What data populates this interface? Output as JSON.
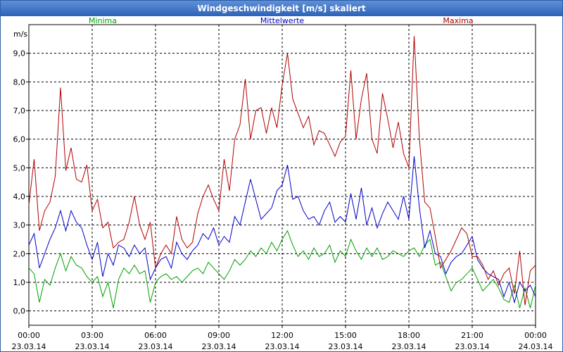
{
  "window": {
    "title": "Windgeschwindigkeit [m/s] skaliert"
  },
  "chart_data": {
    "type": "line",
    "title": "Windgeschwindigkeit [m/s] skaliert",
    "ylabel": "m/s",
    "xlabel": "",
    "ylim": [
      -0.5,
      10.0
    ],
    "xlim": [
      0,
      24
    ],
    "grid": true,
    "legend_position": "top",
    "y_ticks": [
      "0,0",
      "1,0",
      "2,0",
      "3,0",
      "4,0",
      "5,0",
      "6,0",
      "7,0",
      "8,0",
      "9,0"
    ],
    "y_tick_values": [
      0,
      1,
      2,
      3,
      4,
      5,
      6,
      7,
      8,
      9
    ],
    "x_tick_values": [
      0,
      3,
      6,
      9,
      12,
      15,
      18,
      21,
      24
    ],
    "x_ticks_time": [
      "00:00",
      "03:00",
      "06:00",
      "09:00",
      "12:00",
      "15:00",
      "18:00",
      "21:00",
      "00:00"
    ],
    "x_ticks_date": [
      "23.03.14",
      "23.03.14",
      "23.03.14",
      "23.03.14",
      "23.03.14",
      "23.03.14",
      "23.03.14",
      "23.03.14",
      "24.03.14"
    ],
    "x": [
      0.0,
      0.25,
      0.5,
      0.75,
      1.0,
      1.25,
      1.5,
      1.75,
      2.0,
      2.25,
      2.5,
      2.75,
      3.0,
      3.25,
      3.5,
      3.75,
      4.0,
      4.25,
      4.5,
      4.75,
      5.0,
      5.25,
      5.5,
      5.75,
      6.0,
      6.25,
      6.5,
      6.75,
      7.0,
      7.25,
      7.5,
      7.75,
      8.0,
      8.25,
      8.5,
      8.75,
      9.0,
      9.25,
      9.5,
      9.75,
      10.0,
      10.25,
      10.5,
      10.75,
      11.0,
      11.25,
      11.5,
      11.75,
      12.0,
      12.25,
      12.5,
      12.75,
      13.0,
      13.25,
      13.5,
      13.75,
      14.0,
      14.25,
      14.5,
      14.75,
      15.0,
      15.25,
      15.5,
      15.75,
      16.0,
      16.25,
      16.5,
      16.75,
      17.0,
      17.25,
      17.5,
      17.75,
      18.0,
      18.25,
      18.5,
      18.75,
      19.0,
      19.25,
      19.5,
      19.75,
      20.0,
      20.25,
      20.5,
      20.75,
      21.0,
      21.25,
      21.5,
      21.75,
      22.0,
      22.25,
      22.5,
      22.75,
      23.0,
      23.25,
      23.5,
      23.75,
      24.0
    ],
    "series": [
      {
        "name": "Minima",
        "color": "#00a000",
        "values": [
          1.5,
          1.3,
          0.3,
          1.1,
          0.9,
          1.5,
          2.0,
          1.4,
          1.9,
          1.6,
          1.5,
          1.2,
          1.0,
          1.2,
          0.5,
          1.0,
          0.1,
          1.1,
          1.5,
          1.3,
          1.6,
          1.3,
          1.4,
          0.3,
          1.0,
          1.2,
          1.3,
          1.1,
          1.2,
          1.0,
          1.2,
          1.4,
          1.5,
          1.3,
          1.7,
          1.5,
          1.3,
          1.1,
          1.4,
          1.8,
          1.6,
          1.8,
          2.1,
          1.9,
          2.2,
          2.0,
          2.4,
          2.1,
          2.5,
          2.8,
          2.3,
          1.9,
          2.1,
          1.8,
          2.2,
          1.9,
          2.0,
          2.3,
          1.7,
          2.1,
          1.9,
          2.5,
          2.1,
          1.8,
          2.2,
          1.9,
          2.2,
          1.8,
          1.9,
          2.1,
          2.0,
          1.9,
          2.1,
          2.2,
          1.9,
          2.3,
          2.5,
          1.6,
          1.7,
          1.2,
          0.7,
          1.0,
          1.1,
          1.3,
          1.5,
          1.1,
          0.7,
          0.9,
          1.1,
          0.8,
          0.4,
          0.3,
          0.9,
          0.1,
          0.8,
          0.1,
          0.9
        ]
      },
      {
        "name": "Mittelwerte",
        "color": "#0000c8",
        "values": [
          2.3,
          2.7,
          1.5,
          2.0,
          2.5,
          2.9,
          3.5,
          2.8,
          3.5,
          3.1,
          2.9,
          2.3,
          1.8,
          2.4,
          1.2,
          2.0,
          1.6,
          2.3,
          2.2,
          1.9,
          2.3,
          2.0,
          2.2,
          1.1,
          1.5,
          1.8,
          1.9,
          1.5,
          2.4,
          2.0,
          1.8,
          2.1,
          2.3,
          2.7,
          2.5,
          2.9,
          2.3,
          2.6,
          2.4,
          3.3,
          3.0,
          3.8,
          4.6,
          3.9,
          3.2,
          3.4,
          3.6,
          4.2,
          4.4,
          5.1,
          3.9,
          4.0,
          3.5,
          3.2,
          3.3,
          3.0,
          3.5,
          3.8,
          3.1,
          3.3,
          3.1,
          4.1,
          3.2,
          4.3,
          3.0,
          3.6,
          2.9,
          3.4,
          3.8,
          3.5,
          3.2,
          4.0,
          3.2,
          5.4,
          3.6,
          2.2,
          2.8,
          2.0,
          1.9,
          1.3,
          1.7,
          1.9,
          2.0,
          2.3,
          2.6,
          1.8,
          1.5,
          1.3,
          1.2,
          1.1,
          0.5,
          1.0,
          0.3,
          1.0,
          0.7,
          0.9,
          0.5
        ]
      },
      {
        "name": "Maxima",
        "color": "#b00000",
        "values": [
          3.7,
          5.3,
          2.8,
          3.5,
          3.8,
          4.7,
          7.8,
          4.9,
          5.7,
          4.6,
          4.5,
          5.1,
          3.5,
          3.9,
          2.9,
          3.1,
          2.2,
          2.4,
          2.5,
          3.1,
          4.0,
          3.0,
          2.5,
          3.1,
          1.5,
          2.0,
          2.3,
          2.0,
          3.3,
          2.5,
          2.2,
          2.4,
          3.4,
          4.0,
          4.4,
          3.9,
          3.5,
          5.3,
          4.2,
          6.0,
          6.5,
          8.1,
          6.0,
          7.0,
          7.1,
          6.2,
          7.1,
          6.4,
          7.9,
          9.0,
          7.4,
          6.9,
          6.4,
          6.8,
          5.8,
          6.3,
          6.2,
          5.8,
          5.4,
          5.9,
          6.1,
          8.4,
          6.0,
          7.4,
          8.3,
          6.0,
          5.5,
          7.6,
          6.7,
          5.7,
          6.6,
          5.5,
          5.0,
          9.6,
          6.0,
          3.8,
          3.6,
          2.6,
          1.5,
          1.8,
          2.1,
          2.5,
          2.9,
          2.7,
          1.9,
          1.9,
          1.6,
          1.1,
          1.4,
          0.9,
          1.3,
          1.5,
          0.6,
          2.1,
          0.2,
          1.4,
          1.6
        ]
      }
    ]
  }
}
